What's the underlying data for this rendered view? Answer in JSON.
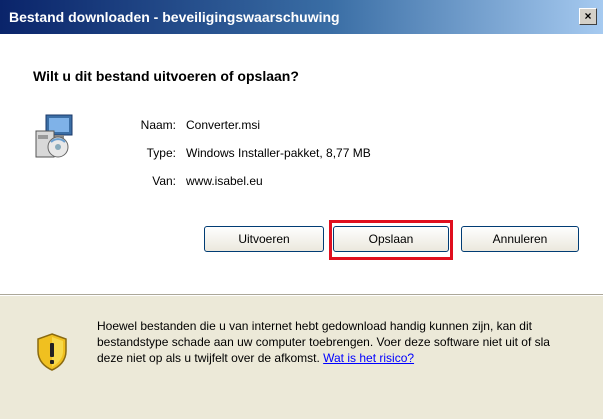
{
  "window": {
    "title": "Bestand downloaden - beveiligingswaarschuwing",
    "close_label": "×"
  },
  "prompt": {
    "question": "Wilt u dit bestand uitvoeren of opslaan?"
  },
  "file": {
    "icon": "installer-package-icon",
    "fields": [
      {
        "label": "Naam:",
        "value": "Converter.msi"
      },
      {
        "label": "Type:",
        "value": "Windows Installer-pakket, 8,77 MB"
      },
      {
        "label": "Van:",
        "value": "www.isabel.eu"
      }
    ]
  },
  "buttons": {
    "run": "Uitvoeren",
    "save": "Opslaan",
    "cancel": "Annuleren"
  },
  "highlight_color": "#e00f1e",
  "warning": {
    "icon": "shield-warning-icon",
    "text": "Hoewel bestanden die u van internet hebt gedownload handig kunnen zijn, kan dit bestandstype schade aan uw computer toebrengen. Voer deze software niet uit of sla deze niet op als u twijfelt over de afkomst.",
    "link": "Wat is het risico?"
  }
}
